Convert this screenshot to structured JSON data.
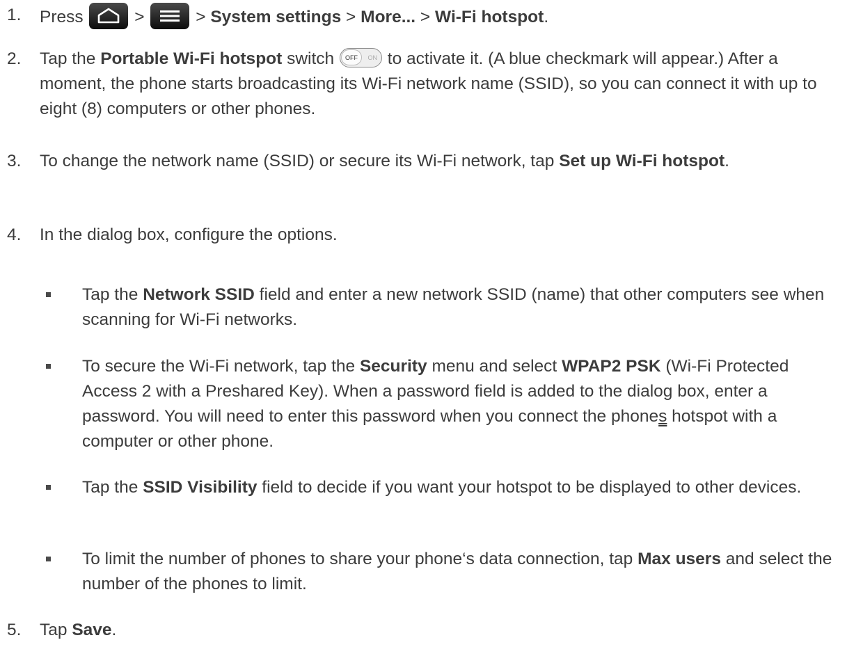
{
  "steps": [
    {
      "num": "1.",
      "t1": "Press",
      "sep1": ">",
      "sep2": "> ",
      "b1": "System settings",
      "sep3": " > ",
      "b2": "More...",
      "sep4": " > ",
      "b3": "Wi-Fi hotspot",
      "end": "."
    },
    {
      "num": "2.",
      "t1": "Tap the ",
      "b1": "Portable Wi-Fi hotspot",
      "t2": " switch ",
      "switch_off": "OFF",
      "switch_on": "ON",
      "t3": " to activate it. (A blue checkmark will appear.) After a moment, the phone starts broadcasting its Wi-Fi network name (SSID), so you can connect it with up to eight (8) computers or other phones."
    },
    {
      "num": "3.",
      "t1": "To change the network name (SSID) or secure its Wi-Fi network, tap ",
      "b1": "Set up Wi-Fi hotspot",
      "end": "."
    },
    {
      "num": "4.",
      "t1": "In the dialog box, configure the options."
    },
    {
      "num": "5.",
      "t1": "Tap ",
      "b1": "Save",
      "end": "."
    }
  ],
  "bullets": [
    {
      "t1": "Tap the ",
      "b1": "Network SSID",
      "t2": " field and enter a new network SSID (name) that other computers see when scanning for Wi-Fi networks."
    },
    {
      "t1": "To secure the Wi-Fi network, tap the ",
      "b1": "Security",
      "t2": " menu and select ",
      "b2": "WPAP2 PSK",
      "t3": " (Wi-Fi Protected Access 2 with a Preshared Key). When a password field is added to the dialog box, enter a password. You will need to enter this password when you connect the phone",
      "u": "s",
      "t4": " hotspot with a computer or other phone."
    },
    {
      "t1": "Tap the ",
      "b1": "SSID Visibility",
      "t2": " field to decide if you want your hotspot to be displayed to other devices."
    },
    {
      "t1": "To limit the number of phones to share your phone‘s data connection, tap ",
      "b1": "Max users",
      "t2": " and select the number of the phones to limit."
    }
  ],
  "icons": {
    "home": "home-key-icon",
    "menu": "menu-key-icon",
    "switch": "off-on-switch-icon",
    "bullet": "square-bullet-icon"
  },
  "colors": {
    "text": "#3c3c3c",
    "key": "#1a1a1a"
  }
}
